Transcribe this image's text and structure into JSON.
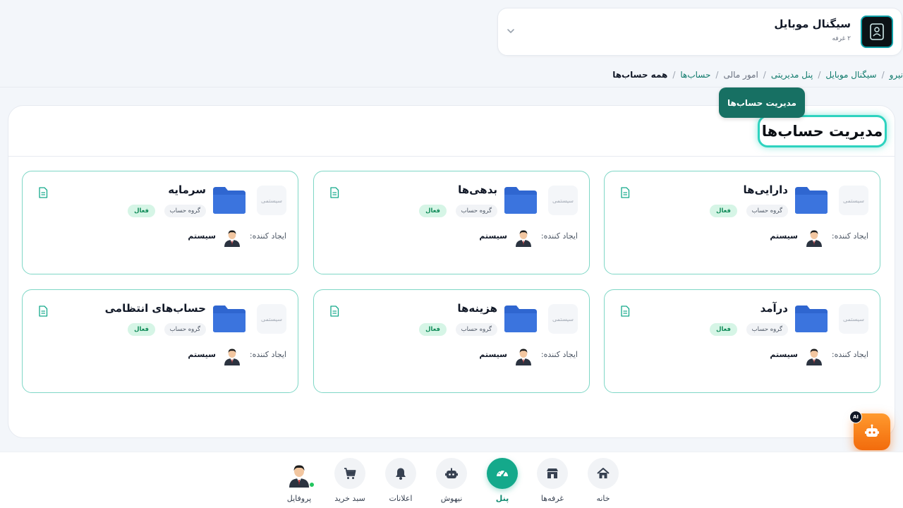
{
  "store": {
    "name": "سیگنال موبایل",
    "subtitle": "۲ غرفه",
    "logo_icon": "store-logo-icon"
  },
  "breadcrumb": [
    {
      "label": "نیرو",
      "type": "link"
    },
    {
      "label": "سیگنال موبایل",
      "type": "link"
    },
    {
      "label": "پنل مدیریتی",
      "type": "link"
    },
    {
      "label": "امور مالی",
      "type": "plain"
    },
    {
      "label": "حساب‌ها",
      "type": "link"
    },
    {
      "label": "همه حساب‌ها",
      "type": "current"
    }
  ],
  "page": {
    "title": "مدیریت حساب‌ها",
    "tooltip": "مدیریت حساب‌ها"
  },
  "card_labels": {
    "system_badge": "سیستمی",
    "group_tag": "گروه حساب",
    "creator_label": "ایجاد کننده:"
  },
  "accounts": [
    {
      "name": "دارایی‌ها",
      "status": "فعال",
      "creator": "سیستم"
    },
    {
      "name": "بدهی‌ها",
      "status": "فعال",
      "creator": "سیستم"
    },
    {
      "name": "سرمایه",
      "status": "فعال",
      "creator": "سیستم"
    },
    {
      "name": "درآمد",
      "status": "فعال",
      "creator": "سیستم"
    },
    {
      "name": "هزینه‌ها",
      "status": "فعال",
      "creator": "سیستم"
    },
    {
      "name": "حساب‌های انتظامی",
      "status": "فعال",
      "creator": "سیستم"
    }
  ],
  "ai_button": {
    "badge": "AI",
    "icon": "robot-icon"
  },
  "nav": [
    {
      "label": "خانه",
      "icon": "home-icon",
      "active": false
    },
    {
      "label": "غرفه‌ها",
      "icon": "store-icon",
      "active": false
    },
    {
      "label": "پنل",
      "icon": "gauge-icon",
      "active": true
    },
    {
      "label": "نیهوش",
      "icon": "robot-icon",
      "active": false
    },
    {
      "label": "اعلانات",
      "icon": "bell-icon",
      "active": false
    },
    {
      "label": "سبد خرید",
      "icon": "cart-icon",
      "active": false
    },
    {
      "label": "پروفایل",
      "icon": "avatar",
      "active": false
    }
  ],
  "colors": {
    "accent": "#14a98b",
    "tooltip": "#177063",
    "card_border": "#7fd7c6",
    "folder": "#2f66d0",
    "status_bg": "#d6f5e6",
    "ai_orange": "#f26b0c"
  }
}
